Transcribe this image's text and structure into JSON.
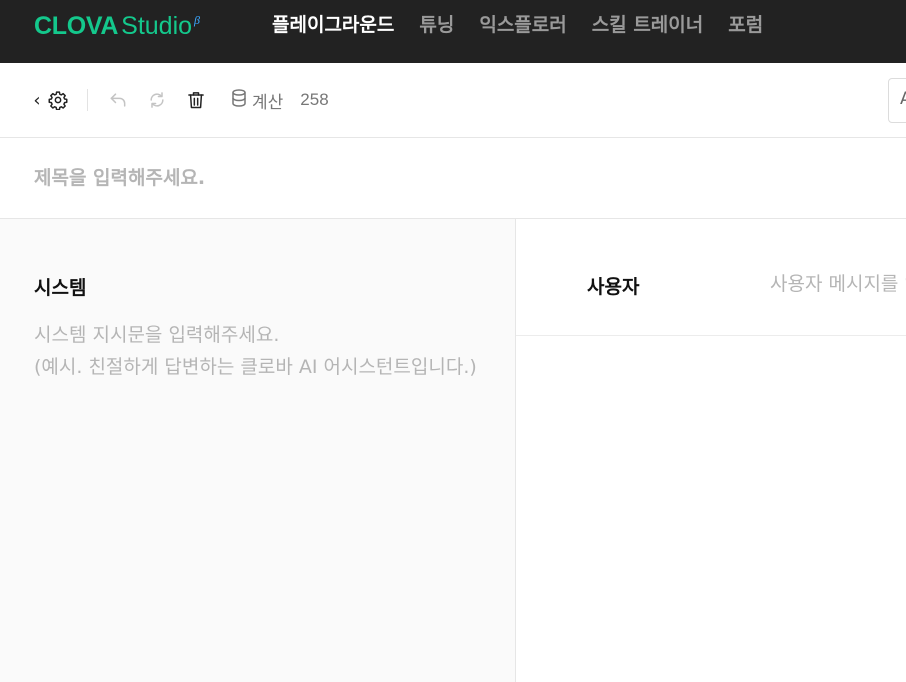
{
  "header": {
    "logo_main": "CLOVA",
    "logo_sub": "Studio",
    "logo_badge": "β",
    "nav": [
      {
        "label": "플레이그라운드",
        "active": true
      },
      {
        "label": "튜닝",
        "active": false
      },
      {
        "label": "익스플로러",
        "active": false
      },
      {
        "label": "스킬 트레이너",
        "active": false
      },
      {
        "label": "포럼",
        "active": false
      }
    ]
  },
  "toolbar": {
    "back_glyph": "‹",
    "icons": [
      "gear-icon",
      "undo-icon",
      "redo-icon",
      "trash-icon",
      "database-icon"
    ],
    "calc_label": "계산",
    "calc_count": "258",
    "right_button_glyph": "A"
  },
  "title": {
    "placeholder": "제목을 입력해주세요."
  },
  "system": {
    "title": "시스템",
    "placeholder": "시스템 지시문을 입력해주세요.\n(예시. 친절하게 답변하는 클로바 AI 어시스턴트입니다.)"
  },
  "user": {
    "label": "사용자",
    "placeholder": "사용자 메시지를 입력해주세요."
  },
  "colors": {
    "topbar_bg": "#222222",
    "brand_green": "#14c88c",
    "beta_blue": "#3aa6ff",
    "nav_active": "#ffffff",
    "nav_inactive": "#9a9a9a",
    "placeholder": "#b5b5b5",
    "system_bg": "#fafafa"
  }
}
